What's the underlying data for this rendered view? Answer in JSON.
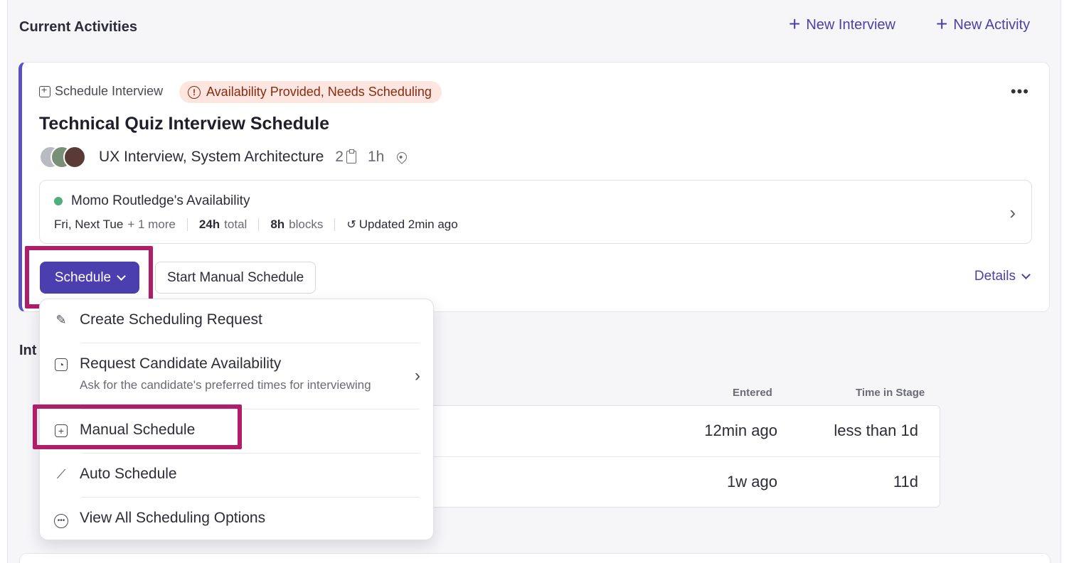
{
  "header": {
    "section_title": "Current Activities",
    "new_interview_label": "New Interview",
    "new_activity_label": "New Activity"
  },
  "activity": {
    "type_label": "Schedule Interview",
    "status_badge": "Availability Provided, Needs Scheduling",
    "title": "Technical Quiz Interview Schedule",
    "interviews": "UX Interview, System Architecture",
    "interview_count": "2",
    "duration": "1h",
    "availability": {
      "name": "Momo Routledge's Availability",
      "days": "Fri, Next Tue",
      "more": "+ 1 more",
      "total_value": "24h",
      "total_label": "total",
      "blocks_value": "8h",
      "blocks_label": "blocks",
      "updated": "Updated 2min ago"
    },
    "schedule_button": "Schedule",
    "manual_button": "Start Manual Schedule",
    "details_link": "Details"
  },
  "section2": {
    "title_peek": "Int"
  },
  "table": {
    "columns": [
      "Entered",
      "Time in Stage"
    ],
    "rows": [
      {
        "entered": "12min ago",
        "time_in_stage": "less than 1d"
      },
      {
        "entered": "1w ago",
        "time_in_stage": "11d"
      }
    ]
  },
  "dropdown": {
    "items": [
      {
        "label": "Create Scheduling Request",
        "icon": "edit-calendar-icon"
      },
      {
        "label": "Request Candidate Availability",
        "sub": "Ask for the candidate's preferred times for interviewing",
        "icon": "calendar-user-icon"
      },
      {
        "label": "Manual Schedule",
        "icon": "calendar-plus-icon"
      },
      {
        "label": "Auto Schedule",
        "icon": "magic-wand-icon"
      },
      {
        "label": "View All Scheduling Options",
        "icon": "more-circle-icon"
      }
    ]
  },
  "colors": {
    "accent": "#4b3fb0",
    "status_bg": "#fde6df",
    "status_text": "#8a2a12",
    "highlight": "#b01e6a",
    "online_dot": "#4fae7a"
  }
}
